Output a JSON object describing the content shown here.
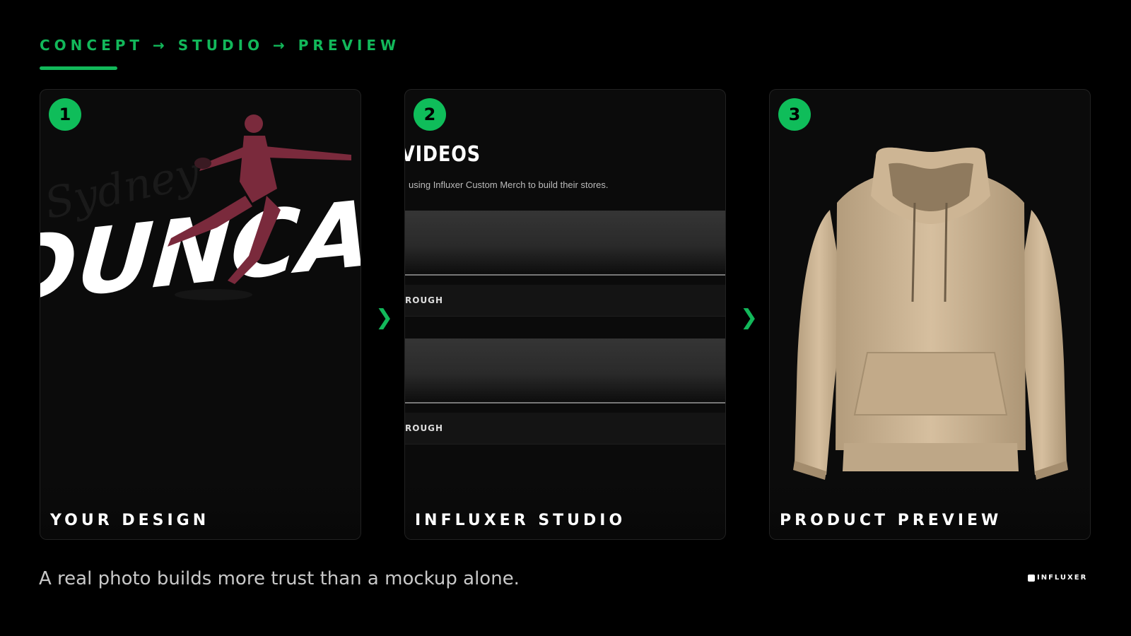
{
  "header": {
    "eyebrow": "CONCEPT → STUDIO → PREVIEW"
  },
  "steps": [
    {
      "number": "1",
      "label": "YOUR DESIGN",
      "artwork_script": "Sydney",
      "artwork_title": "DUNCAN"
    },
    {
      "number": "2",
      "label": "INFLUXER STUDIO"
    },
    {
      "number": "3",
      "label": "PRODUCT PREVIEW"
    }
  ],
  "studio": {
    "heading": "VIDEOS",
    "subtitle": "using Influxer Custom Merch to build their stores.",
    "row1": "ROUGH",
    "row2": "ROUGH"
  },
  "arrow_glyph": "❯",
  "caption": "A real photo builds more trust than a mockup alone.",
  "brand": {
    "name": "INFLUXER"
  },
  "colors": {
    "accent": "#12b85a",
    "hoodie": "#cdb594"
  }
}
